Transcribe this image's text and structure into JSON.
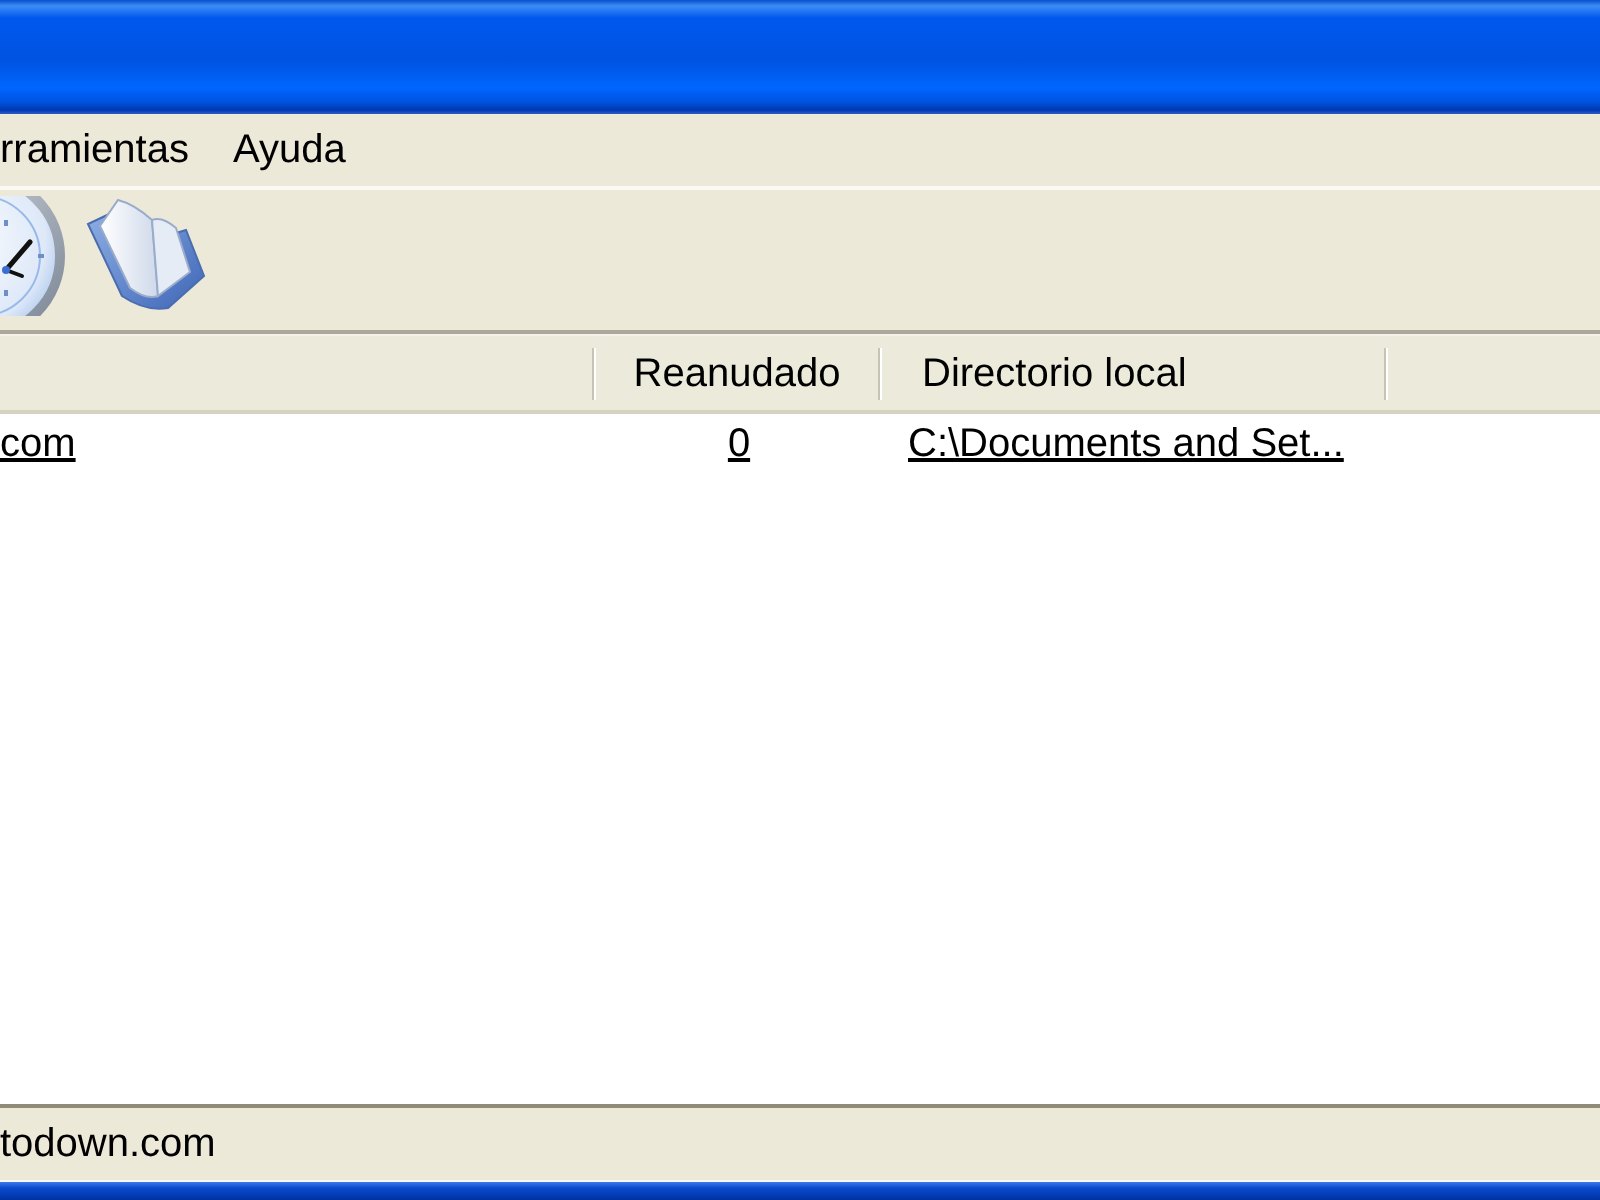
{
  "menu": [
    {
      "label": "rramientas"
    },
    {
      "label": "Ayuda"
    }
  ],
  "table": {
    "columns": [
      "",
      "Reanudado",
      "Directorio local"
    ],
    "rows": [
      {
        "cells": [
          "com",
          "0",
          "C:\\Documents and Set..."
        ]
      }
    ]
  },
  "status_bar": {
    "text": "todown.com"
  }
}
